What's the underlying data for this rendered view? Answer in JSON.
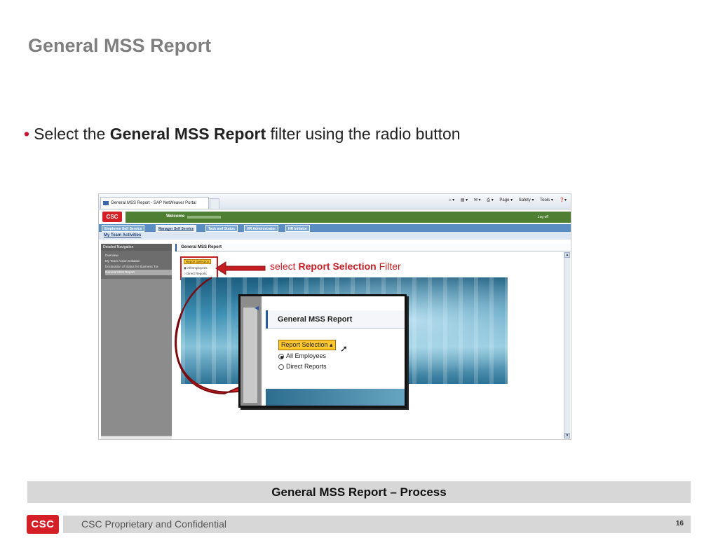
{
  "slide": {
    "title": "General MSS Report",
    "bullet": {
      "prefix": "Select the ",
      "bold": "General MSS Report",
      "suffix": " filter using the radio button"
    },
    "callout": {
      "prefix": "select ",
      "bold": "Report Selection",
      "suffix": " Filter"
    },
    "process_caption": "General MSS Report – Process",
    "footer_text": "CSC Proprietary and Confidential",
    "page_number": "16",
    "logo_text": "CSC"
  },
  "browser": {
    "tab_title": "General MSS Report - SAP NetWeaver Portal",
    "tools": [
      "Page ▾",
      "Safety ▾",
      "Tools ▾"
    ]
  },
  "portal": {
    "logo_text": "CSC",
    "welcome": "Welcome",
    "logoff": "Log off",
    "tabs": [
      "Employee Self Service",
      "Manager Self Service",
      "Task and Status",
      "HR Administrator",
      "HR Initiator"
    ],
    "active_tab": "Manager Self Service",
    "subtab": "My Team Activities",
    "nav_header": "Detailed Navigation",
    "nav_items": [
      "Overview",
      "My Team Action Initiation",
      "Declaration of Status for Business Tra",
      "General MSS Report"
    ],
    "selected_nav": "General MSS Report",
    "content_title": "General MSS Report",
    "filter": {
      "button": "Report Selection",
      "options": [
        "All Employees",
        "Direct Reports"
      ],
      "selected": "All Employees"
    }
  },
  "colors": {
    "accent_red": "#c41e22",
    "portal_green": "#4f7f32",
    "highlight_yellow": "#ffc92e"
  }
}
